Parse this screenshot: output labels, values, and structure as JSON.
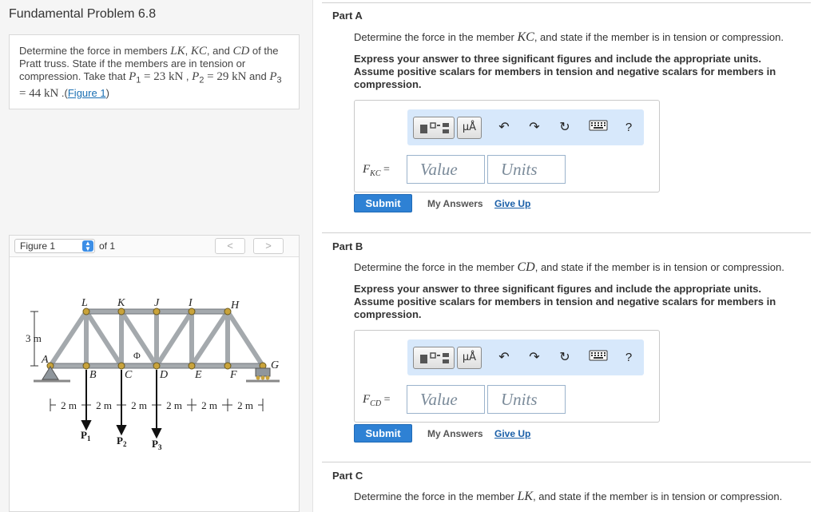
{
  "problem": {
    "title": "Fundamental Problem 6.8",
    "text_1": "Determine the force in members ",
    "m_lk": "LK",
    "sep_1": ", ",
    "m_kc": "KC",
    "sep_2": ", and ",
    "m_cd": "CD",
    "text_2": " of the Pratt truss. State if the members are in tension or compression. Take that ",
    "p1_sym": "P",
    "p1_sub": "1",
    "p1_val": " = 23 kN",
    "text_3": " , ",
    "p2_sym": "P",
    "p2_sub": "2",
    "p2_val": " = 29 kN",
    "text_4": " and ",
    "p3_sym": "P",
    "p3_sub": "3",
    "p3_val": " = 44 kN",
    "text_5": " .(",
    "figure_link": "Figure 1",
    "text_6": ")"
  },
  "figure": {
    "selector": "Figure 1",
    "of_label": "of 1",
    "prev": "<",
    "next": ">",
    "top_nodes": [
      "L",
      "K",
      "J",
      "I",
      "H"
    ],
    "bottom_nodes": [
      "A",
      "B",
      "C",
      "D",
      "E",
      "F",
      "G"
    ],
    "height_label": "3 m",
    "spans": [
      "2 m",
      "2 m",
      "2 m",
      "2 m",
      "2 m",
      "2 m"
    ],
    "loads": [
      {
        "sym": "P",
        "sub": "1"
      },
      {
        "sym": "P",
        "sub": "2"
      },
      {
        "sym": "P",
        "sub": "3"
      }
    ],
    "hidden_label": "Φ"
  },
  "toolbar": {
    "units_label": "μÅ",
    "undo": "↶",
    "redo": "↷",
    "reset": "↻",
    "help": "?"
  },
  "parts": [
    {
      "title": "Part A",
      "q_pre": "Determine the force in the member ",
      "q_member": "KC",
      "q_post": ", and state if the member is in tension or compression.",
      "instructions": "Express your answer to three significant figures and include the appropriate units. Assume positive scalars for members in tension and negative scalars for members in compression.",
      "label_sym": "F",
      "label_sub": "KC",
      "label_eq": " = ",
      "value_placeholder": "Value",
      "units_placeholder": "Units",
      "submit": "Submit",
      "my_answers": "My Answers",
      "give_up": "Give Up"
    },
    {
      "title": "Part B",
      "q_pre": "Determine the force in the member ",
      "q_member": "CD",
      "q_post": ", and state if the member is in tension or compression.",
      "instructions": "Express your answer to three significant figures and include the appropriate units. Assume positive scalars for members in tension and negative scalars for members in compression.",
      "label_sym": "F",
      "label_sub": "CD",
      "label_eq": " = ",
      "value_placeholder": "Value",
      "units_placeholder": "Units",
      "submit": "Submit",
      "my_answers": "My Answers",
      "give_up": "Give Up"
    },
    {
      "title": "Part C",
      "q_pre": "Determine the force in the member ",
      "q_member": "LK",
      "q_post": ", and state if the member is in tension or compression."
    }
  ]
}
